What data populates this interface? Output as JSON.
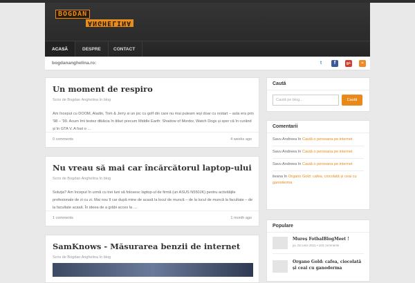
{
  "header": {
    "logo_line1": "BOGDAN",
    "logo_line2": "ANGHELINA",
    "nav": [
      "ACASĂ",
      "DESPRE",
      "CONTACT"
    ]
  },
  "subbar": {
    "site": "bogdananghelina.ro:",
    "social": [
      "twitter-icon",
      "facebook-icon",
      "google-plus-icon",
      "rss-icon"
    ]
  },
  "posts": [
    {
      "title": "Un moment de respiro",
      "meta": "Scris de Bogdan Anghelina în blog",
      "excerpt": "Am început cu DOOM, Aladin, Tom & Jerry si un joc cu golf din care nu mai puteam ieși doar cu restart – asta era prin '98 – '99. Acum îmi testez dibăcia în titluri precum Middle Earth: Shadow of Mordor, Watch Dogs și sper că în curând și în GTA V. A fost o …",
      "comments": "0 comments",
      "ago": "4 weeks ago"
    },
    {
      "title": "Nu vreau să mai car încărcătorul laptop-ului",
      "meta": "Scris de Bogdan Anghelina în blog",
      "excerpt": "Soluția? Am început în urmă cu trei luni să folosesc laptop-ul de firmă (un ASUS N550JK) pentru activitățile profesionale de zi cu zi. Mai nou îl car după mine de acasă la locul de muncă – de la locul de muncă la facultate – de la facultate acasă. În ideea de a grăbi acces la …",
      "comments": "1 comments",
      "ago": "1 month ago"
    },
    {
      "title": "SamKnows - Măsurarea benzii de internet",
      "meta": "Scris de Bogdan Anghelina în blog"
    }
  ],
  "search": {
    "title": "Caută",
    "placeholder": "Caută pe blog...",
    "button": "Caută"
  },
  "comments": {
    "title": "Comentarii",
    "items": [
      {
        "author": "Savu Andreea",
        "in": "în",
        "post": "Caută o persoana pe internet"
      },
      {
        "author": "Savu Andreea",
        "in": "în",
        "post": "Caută o persoana pe internet"
      },
      {
        "author": "Savu Andreea",
        "in": "în",
        "post": "Caută o persoana pe internet"
      },
      {
        "author": "ileana",
        "in": "în",
        "post": "Organo Gold: cafea, ciocolată și ceai cu ganoderma"
      }
    ]
  },
  "popular": {
    "title": "Populare",
    "items": [
      {
        "title": "Mureș FotbalBlogMeet !",
        "meta": "joi, 02 iunie 2011 • 103 comments"
      },
      {
        "title": "Organo Gold: cafea, ciocolată și ceai cu ganoderma",
        "meta": ""
      }
    ]
  },
  "colors": {
    "accent": "#e78a18",
    "header": "#2b2b2b"
  }
}
